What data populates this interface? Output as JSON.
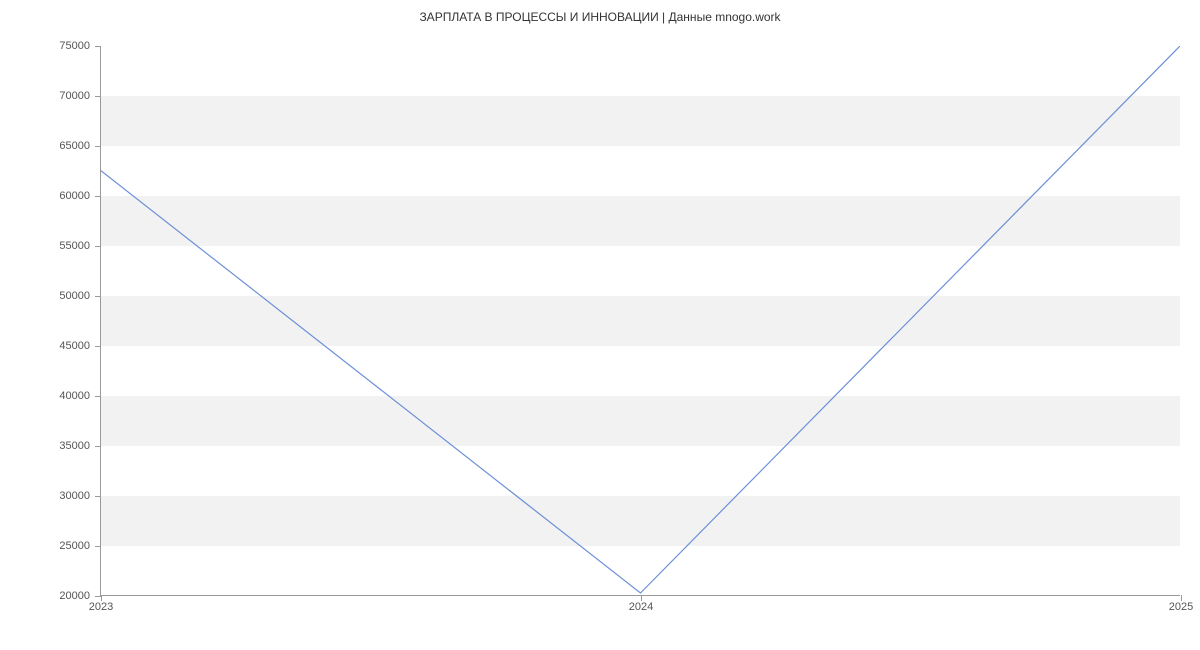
{
  "title": "ЗАРПЛАТА В  ПРОЦЕССЫ И ИННОВАЦИИ | Данные mnogo.work",
  "chart_data": {
    "type": "line",
    "x": [
      "2023",
      "2024",
      "2025"
    ],
    "values": [
      62500,
      20200,
      75000
    ],
    "title": "ЗАРПЛАТА В  ПРОЦЕССЫ И ИННОВАЦИИ | Данные mnogo.work",
    "xlabel": "",
    "ylabel": "",
    "ylim": [
      20000,
      75000
    ],
    "y_ticks": [
      20000,
      25000,
      30000,
      35000,
      40000,
      45000,
      50000,
      55000,
      60000,
      65000,
      70000,
      75000
    ],
    "x_ticks": [
      "2023",
      "2024",
      "2025"
    ],
    "line_color": "#6a8fd8"
  }
}
